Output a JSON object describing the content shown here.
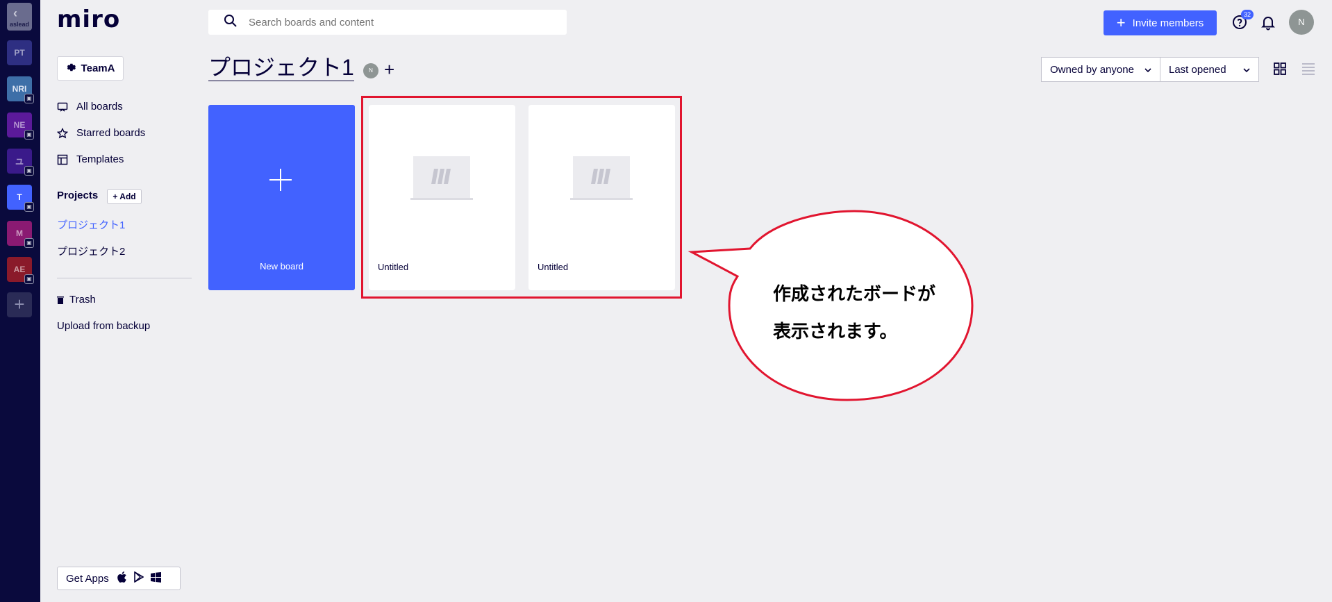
{
  "rail": {
    "top_label": "aslead",
    "teams": [
      {
        "label": "PT",
        "color": "#2e2f82",
        "locked": false,
        "active": false
      },
      {
        "label": "NRI",
        "color": "#3e6fa8",
        "locked": true,
        "active": false
      },
      {
        "label": "NE",
        "color": "#5b1a9a",
        "locked": true,
        "active": false
      },
      {
        "label": "ユ",
        "color": "#3a1a8a",
        "locked": true,
        "active": false
      },
      {
        "label": "T",
        "color": "#4262ff",
        "locked": true,
        "active": true
      },
      {
        "label": "M",
        "color": "#8a1a72",
        "locked": true,
        "active": false
      },
      {
        "label": "AE",
        "color": "#8a1a2a",
        "locked": true,
        "active": false
      }
    ],
    "add_label": "+"
  },
  "sidebar": {
    "logo": "miro",
    "team_name": "TeamA",
    "nav": {
      "all_boards": "All boards",
      "starred_boards": "Starred boards",
      "templates": "Templates"
    },
    "projects_heading": "Projects",
    "add_project": "+ Add",
    "projects": [
      "プロジェクト1",
      "プロジェクト2"
    ],
    "trash": "Trash",
    "upload": "Upload from backup",
    "get_apps": "Get Apps"
  },
  "topbar": {
    "search_placeholder": "Search boards and content",
    "invite_label": "Invite members",
    "help_badge": "32",
    "avatar_initial": "N"
  },
  "header": {
    "title": "プロジェクト1",
    "member_initial": "N",
    "add_member": "+",
    "filter_owner": "Owned by anyone",
    "filter_sort": "Last opened"
  },
  "boards": {
    "new_board_label": "New board",
    "items": [
      {
        "title": "Untitled"
      },
      {
        "title": "Untitled"
      }
    ]
  },
  "annotation": {
    "line1": "作成されたボードが",
    "line2": "表示されます。",
    "highlight_color": "#e1152f"
  },
  "colors": {
    "accent": "#4262ff",
    "rail_bg": "#0a0a3d",
    "page_bg": "#efeff2"
  }
}
